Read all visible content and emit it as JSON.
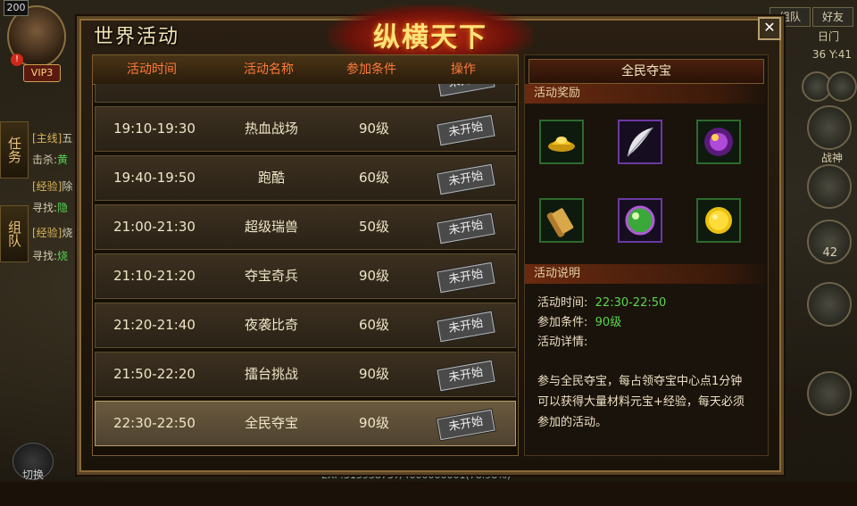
{
  "hud": {
    "level": "200",
    "vip": "VIP3",
    "alert": "!",
    "tabs": [
      "任务",
      "组队"
    ],
    "quests": [
      {
        "tag": "[主线]",
        "text": "五"
      },
      {
        "tag": "击杀:",
        "val": "黄"
      },
      {
        "tag": "[经验]",
        "text": "除"
      },
      {
        "tag": "寻找:",
        "val": "隐"
      },
      {
        "tag": "[经验]",
        "text": "烧"
      },
      {
        "tag": "寻找:",
        "val": "烧"
      }
    ],
    "switch_label": "切换",
    "exp_text": "EXP:315938737/4000000001(78.98%)",
    "top_buttons": [
      "组队",
      "好友"
    ],
    "map_name": "日门",
    "coords": "36 Y:41",
    "war_god": "战神",
    "level_right": "42"
  },
  "panel": {
    "title": "世界活动",
    "banner": "纵横天下",
    "close": "✕"
  },
  "table": {
    "headers": [
      "活动时间",
      "活动名称",
      "参加条件",
      "操作"
    ],
    "rows": [
      {
        "time": "",
        "name": "",
        "cond": "",
        "op": "未开始"
      },
      {
        "time": "19:10-19:30",
        "name": "热血战场",
        "cond": "90级",
        "op": "未开始"
      },
      {
        "time": "19:40-19:50",
        "name": "跑酷",
        "cond": "60级",
        "op": "未开始"
      },
      {
        "time": "21:00-21:30",
        "name": "超级瑞兽",
        "cond": "50级",
        "op": "未开始"
      },
      {
        "time": "21:10-21:20",
        "name": "夺宝奇兵",
        "cond": "90级",
        "op": "未开始"
      },
      {
        "time": "21:20-21:40",
        "name": "夜袭比奇",
        "cond": "60级",
        "op": "未开始"
      },
      {
        "time": "21:50-22:20",
        "name": "擂台挑战",
        "cond": "90级",
        "op": "未开始"
      },
      {
        "time": "22:30-22:50",
        "name": "全民夺宝",
        "cond": "90级",
        "op": "未开始"
      }
    ],
    "selected_index": 7
  },
  "detail": {
    "title": "全民夺宝",
    "rewards_label": "活动奖励",
    "rewards": [
      "gold-ingot-icon",
      "feather-icon",
      "purple-orb-icon",
      "scroll-icon",
      "green-gem-icon",
      "gold-coin-icon"
    ],
    "info_label": "活动说明",
    "time_label": "活动时间:",
    "time_value": "22:30-22:50",
    "cond_label": "参加条件:",
    "cond_value": "90级",
    "detail_label": "活动详情:",
    "description": "参与全民夺宝，每占领夺宝中心点1分钟可以获得大量材料元宝+经验，每天必须参加的活动。"
  }
}
